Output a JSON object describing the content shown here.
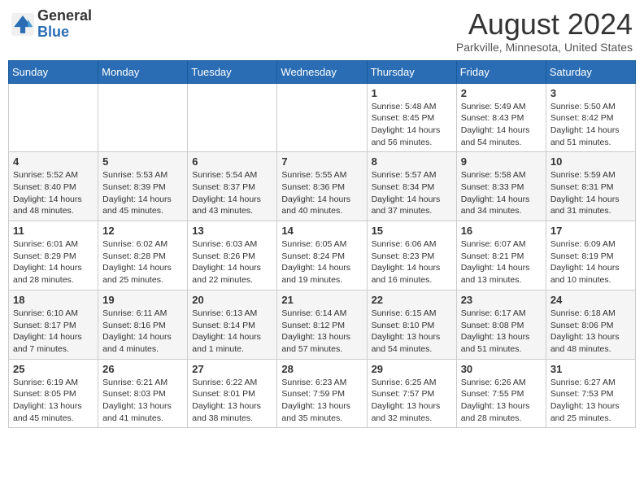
{
  "logo": {
    "text_general": "General",
    "text_blue": "Blue"
  },
  "header": {
    "title": "August 2024",
    "subtitle": "Parkville, Minnesota, United States"
  },
  "weekdays": [
    "Sunday",
    "Monday",
    "Tuesday",
    "Wednesday",
    "Thursday",
    "Friday",
    "Saturday"
  ],
  "weeks": [
    [
      {
        "day": "",
        "info": ""
      },
      {
        "day": "",
        "info": ""
      },
      {
        "day": "",
        "info": ""
      },
      {
        "day": "",
        "info": ""
      },
      {
        "day": "1",
        "info": "Sunrise: 5:48 AM\nSunset: 8:45 PM\nDaylight: 14 hours\nand 56 minutes."
      },
      {
        "day": "2",
        "info": "Sunrise: 5:49 AM\nSunset: 8:43 PM\nDaylight: 14 hours\nand 54 minutes."
      },
      {
        "day": "3",
        "info": "Sunrise: 5:50 AM\nSunset: 8:42 PM\nDaylight: 14 hours\nand 51 minutes."
      }
    ],
    [
      {
        "day": "4",
        "info": "Sunrise: 5:52 AM\nSunset: 8:40 PM\nDaylight: 14 hours\nand 48 minutes."
      },
      {
        "day": "5",
        "info": "Sunrise: 5:53 AM\nSunset: 8:39 PM\nDaylight: 14 hours\nand 45 minutes."
      },
      {
        "day": "6",
        "info": "Sunrise: 5:54 AM\nSunset: 8:37 PM\nDaylight: 14 hours\nand 43 minutes."
      },
      {
        "day": "7",
        "info": "Sunrise: 5:55 AM\nSunset: 8:36 PM\nDaylight: 14 hours\nand 40 minutes."
      },
      {
        "day": "8",
        "info": "Sunrise: 5:57 AM\nSunset: 8:34 PM\nDaylight: 14 hours\nand 37 minutes."
      },
      {
        "day": "9",
        "info": "Sunrise: 5:58 AM\nSunset: 8:33 PM\nDaylight: 14 hours\nand 34 minutes."
      },
      {
        "day": "10",
        "info": "Sunrise: 5:59 AM\nSunset: 8:31 PM\nDaylight: 14 hours\nand 31 minutes."
      }
    ],
    [
      {
        "day": "11",
        "info": "Sunrise: 6:01 AM\nSunset: 8:29 PM\nDaylight: 14 hours\nand 28 minutes."
      },
      {
        "day": "12",
        "info": "Sunrise: 6:02 AM\nSunset: 8:28 PM\nDaylight: 14 hours\nand 25 minutes."
      },
      {
        "day": "13",
        "info": "Sunrise: 6:03 AM\nSunset: 8:26 PM\nDaylight: 14 hours\nand 22 minutes."
      },
      {
        "day": "14",
        "info": "Sunrise: 6:05 AM\nSunset: 8:24 PM\nDaylight: 14 hours\nand 19 minutes."
      },
      {
        "day": "15",
        "info": "Sunrise: 6:06 AM\nSunset: 8:23 PM\nDaylight: 14 hours\nand 16 minutes."
      },
      {
        "day": "16",
        "info": "Sunrise: 6:07 AM\nSunset: 8:21 PM\nDaylight: 14 hours\nand 13 minutes."
      },
      {
        "day": "17",
        "info": "Sunrise: 6:09 AM\nSunset: 8:19 PM\nDaylight: 14 hours\nand 10 minutes."
      }
    ],
    [
      {
        "day": "18",
        "info": "Sunrise: 6:10 AM\nSunset: 8:17 PM\nDaylight: 14 hours\nand 7 minutes."
      },
      {
        "day": "19",
        "info": "Sunrise: 6:11 AM\nSunset: 8:16 PM\nDaylight: 14 hours\nand 4 minutes."
      },
      {
        "day": "20",
        "info": "Sunrise: 6:13 AM\nSunset: 8:14 PM\nDaylight: 14 hours\nand 1 minute."
      },
      {
        "day": "21",
        "info": "Sunrise: 6:14 AM\nSunset: 8:12 PM\nDaylight: 13 hours\nand 57 minutes."
      },
      {
        "day": "22",
        "info": "Sunrise: 6:15 AM\nSunset: 8:10 PM\nDaylight: 13 hours\nand 54 minutes."
      },
      {
        "day": "23",
        "info": "Sunrise: 6:17 AM\nSunset: 8:08 PM\nDaylight: 13 hours\nand 51 minutes."
      },
      {
        "day": "24",
        "info": "Sunrise: 6:18 AM\nSunset: 8:06 PM\nDaylight: 13 hours\nand 48 minutes."
      }
    ],
    [
      {
        "day": "25",
        "info": "Sunrise: 6:19 AM\nSunset: 8:05 PM\nDaylight: 13 hours\nand 45 minutes."
      },
      {
        "day": "26",
        "info": "Sunrise: 6:21 AM\nSunset: 8:03 PM\nDaylight: 13 hours\nand 41 minutes."
      },
      {
        "day": "27",
        "info": "Sunrise: 6:22 AM\nSunset: 8:01 PM\nDaylight: 13 hours\nand 38 minutes."
      },
      {
        "day": "28",
        "info": "Sunrise: 6:23 AM\nSunset: 7:59 PM\nDaylight: 13 hours\nand 35 minutes."
      },
      {
        "day": "29",
        "info": "Sunrise: 6:25 AM\nSunset: 7:57 PM\nDaylight: 13 hours\nand 32 minutes."
      },
      {
        "day": "30",
        "info": "Sunrise: 6:26 AM\nSunset: 7:55 PM\nDaylight: 13 hours\nand 28 minutes."
      },
      {
        "day": "31",
        "info": "Sunrise: 6:27 AM\nSunset: 7:53 PM\nDaylight: 13 hours\nand 25 minutes."
      }
    ]
  ]
}
